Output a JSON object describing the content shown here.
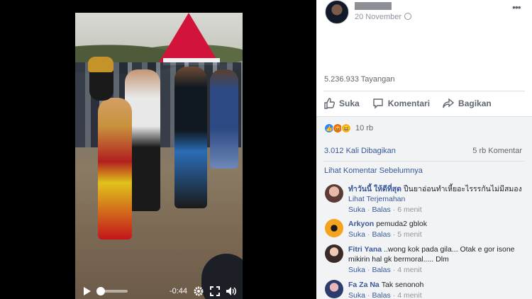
{
  "video": {
    "time_remaining": "-0:44",
    "progress": 0.05
  },
  "post": {
    "date": "20 November",
    "views": "5.236.933 Tayangan",
    "actions": {
      "like": "Suka",
      "comment": "Komentari",
      "share": "Bagikan"
    },
    "reaction_count": "10 rb",
    "shares": "3.012 Kali Dibagikan",
    "comments_count": "5 rb Komentar",
    "prev_comments": "Lihat Komentar Sebelumnya"
  },
  "comments": [
    {
      "name": "ทำวันนี้ ให้ดีที่สุด",
      "text": "ปืนยาอ่อนทำเหี้ยอะไรรรกันไม่มีสมอง",
      "translate": "Lihat Terjemahan",
      "like": "Suka",
      "reply": "Balas",
      "time": "6 menit"
    },
    {
      "name": "Arkyon",
      "text": "pemuda2 gblok",
      "like": "Suka",
      "reply": "Balas",
      "time": "5 menit"
    },
    {
      "name": "Fitri Yana",
      "text": "..wong kok pada gila... Otak e gor isone mikirin hal gk bermoral..... Dlm",
      "like": "Suka",
      "reply": "Balas",
      "time": "4 menit"
    },
    {
      "name": "Fa Za Na",
      "text": "Tak senonoh",
      "like": "Suka",
      "reply": "Balas",
      "time": "4 menit"
    }
  ],
  "colors": {
    "link": "#385898",
    "like_blue": "#2d88ff",
    "panel_bg": "#f2f3f5"
  }
}
